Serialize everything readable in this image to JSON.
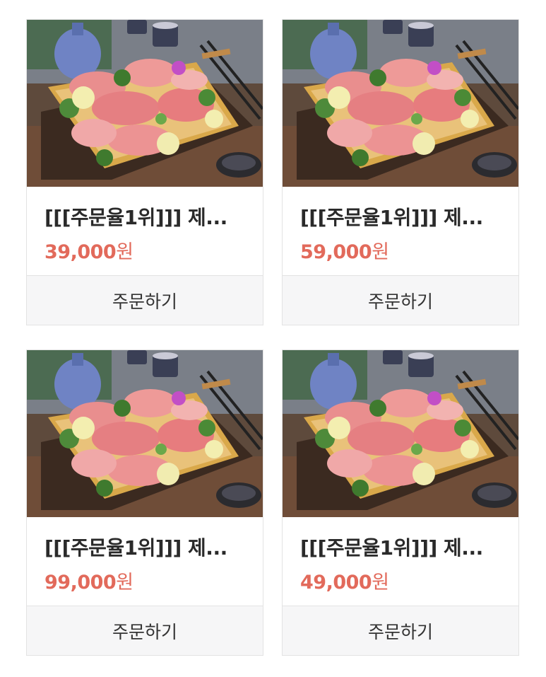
{
  "products": [
    {
      "image": "sashimi-platter",
      "title": "[[[주문율1위]]] 제...",
      "price": "39,000",
      "currency": "원",
      "order_label": "주문하기"
    },
    {
      "image": "sashimi-platter",
      "title": "[[[주문율1위]]] 제...",
      "price": "59,000",
      "currency": "원",
      "order_label": "주문하기"
    },
    {
      "image": "sashimi-platter",
      "title": "[[[주문율1위]]] 제...",
      "price": "99,000",
      "currency": "원",
      "order_label": "주문하기"
    },
    {
      "image": "sashimi-platter",
      "title": "[[[주문율1위]]] 제...",
      "price": "49,000",
      "currency": "원",
      "order_label": "주문하기"
    }
  ],
  "colors": {
    "price": "#e26a5b",
    "button_bg": "#f6f6f7",
    "border": "#e3e3e3"
  }
}
